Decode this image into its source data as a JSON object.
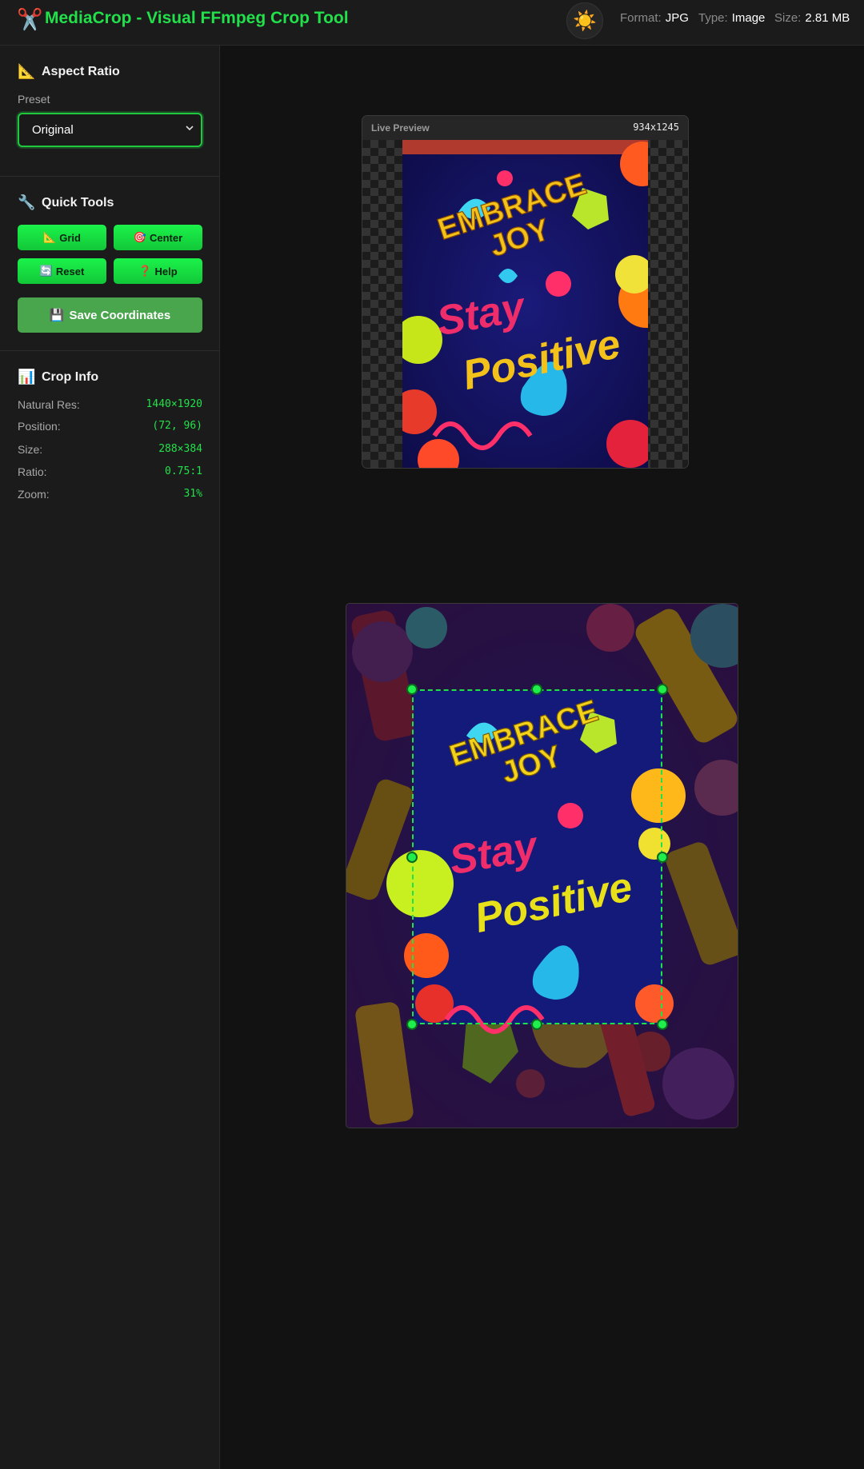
{
  "app": {
    "logo_icon": "scissors-icon",
    "title": "MediaCrop - Visual FFmpeg Crop Tool",
    "theme_toggle_icon": "sun-icon"
  },
  "file_meta": {
    "format_label": "Format:",
    "format": "JPG",
    "type_label": "Type:",
    "type": "Image",
    "size_label": "Size:",
    "size": "2.81 MB"
  },
  "sidebar": {
    "aspect_ratio": {
      "icon": "triangle-ruler-icon",
      "title": "Aspect Ratio",
      "preset_label": "Preset",
      "preset_value": "Original"
    },
    "quick_tools": {
      "icon": "wrench-icon",
      "title": "Quick Tools",
      "buttons": [
        {
          "icon": "triangle-ruler-icon",
          "label": "Grid"
        },
        {
          "icon": "target-icon",
          "label": "Center"
        },
        {
          "icon": "refresh-icon",
          "label": "Reset"
        },
        {
          "icon": "question-icon",
          "label": "Help"
        }
      ],
      "save": {
        "icon": "floppy-disk-icon",
        "label": "Save Coordinates"
      }
    },
    "crop_info": {
      "icon": "bar-chart-icon",
      "title": "Crop Info",
      "rows": [
        {
          "label": "Natural Res:",
          "value": "1440×1920"
        },
        {
          "label": "Position:",
          "value": "(72, 96)"
        },
        {
          "label": "Size:",
          "value": "288×384"
        },
        {
          "label": "Ratio:",
          "value": "0.75:1"
        },
        {
          "label": "Zoom:",
          "value": "31%"
        }
      ]
    }
  },
  "preview": {
    "label": "Live Preview",
    "dimensions": "934x1245"
  },
  "artwork": {
    "line1": "EMBRACE",
    "line2": "JOY",
    "line3": "Stay",
    "line4": "Positive"
  },
  "colors": {
    "accent": "#22e04a",
    "background": "#121212",
    "panel": "#1b1b1b",
    "save_button": "#49a64d"
  }
}
